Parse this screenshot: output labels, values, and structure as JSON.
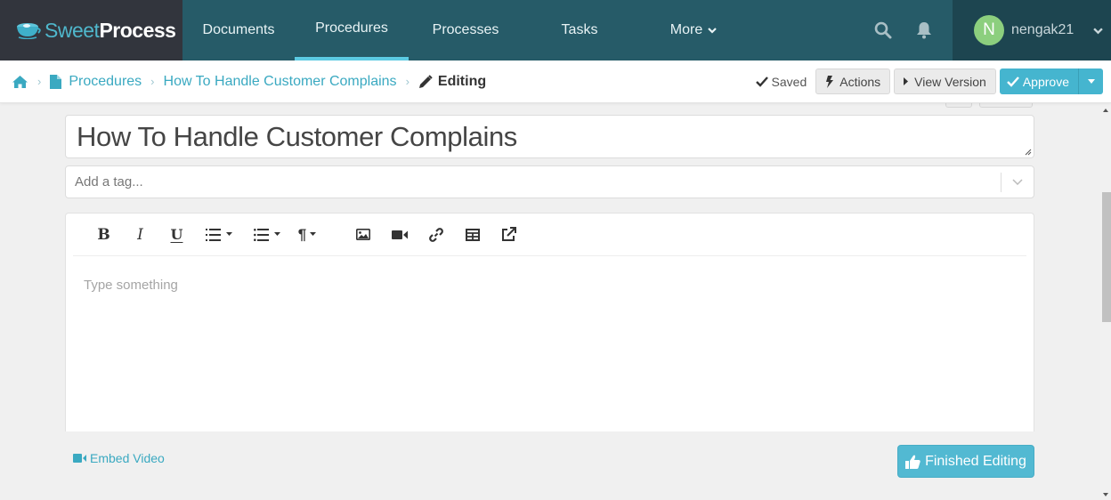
{
  "brand": {
    "name_part1": "Sweet",
    "name_part2": "Process"
  },
  "nav": {
    "items": [
      {
        "label": "Documents",
        "active": false
      },
      {
        "label": "Procedures",
        "active": true
      },
      {
        "label": "Processes",
        "active": false
      },
      {
        "label": "Tasks",
        "active": false
      },
      {
        "label": "More",
        "active": false
      }
    ],
    "search_icon": "search-icon",
    "notifications_icon": "bell-icon",
    "user": {
      "initial": "N",
      "name": "nengak21"
    }
  },
  "breadcrumb": {
    "home_icon": "home-icon",
    "items": [
      {
        "label": "Procedures",
        "icon": "document-icon"
      },
      {
        "label": "How To Handle Customer Complains"
      }
    ],
    "current": "Editing",
    "current_icon": "pencil-icon"
  },
  "actions": {
    "saved_label": "Saved",
    "actions_label": "Actions",
    "view_version_label": "View Version",
    "approve_label": "Approve"
  },
  "form": {
    "title_value": "How To Handle Customer Complains",
    "tag_placeholder": "Add a tag..."
  },
  "editor": {
    "toolbar": [
      "bold",
      "italic",
      "underline",
      "ordered-list",
      "unordered-list",
      "paragraph-format",
      "insert-image",
      "insert-video",
      "insert-link",
      "insert-table",
      "open-external"
    ],
    "bold_glyph": "B",
    "italic_glyph": "I",
    "underline_glyph": "U",
    "paragraph_glyph": "¶",
    "placeholder": "Type something"
  },
  "footer": {
    "embed_video_label": "Embed Video",
    "finished_editing_label": "Finished Editing"
  },
  "colors": {
    "nav_bg": "#265b68",
    "brand_bg": "#32353d",
    "user_bg": "#1d4550",
    "accent": "#45b5cf",
    "active_tab_underline": "#5ccbe3",
    "avatar": "#8ccf7e",
    "link": "#3aa9c1"
  }
}
